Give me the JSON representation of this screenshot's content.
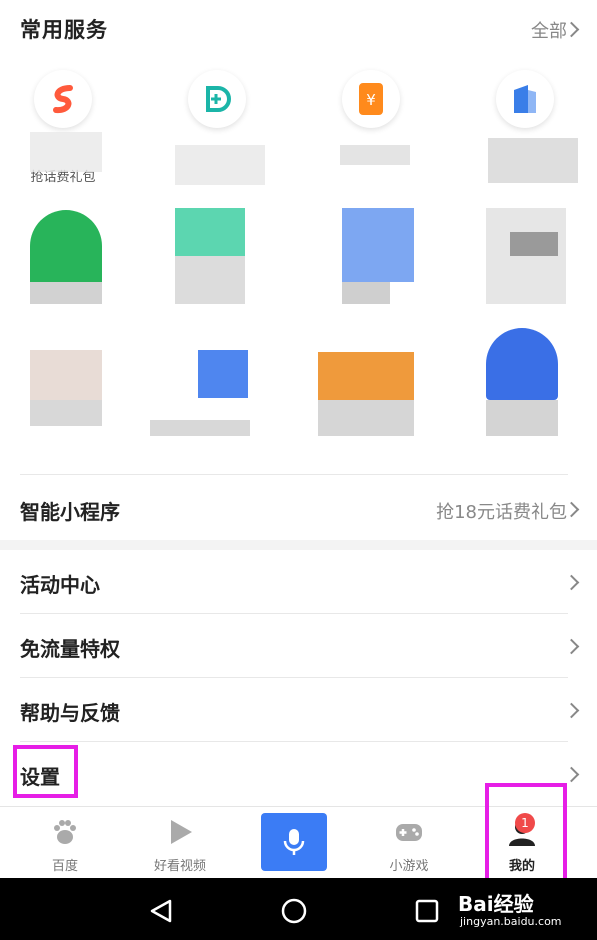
{
  "header": {
    "title": "常用服务",
    "all_label": "全部"
  },
  "services": [
    {
      "label": "抢话费礼包",
      "icon": "s-logo-icon",
      "color": "#ff5a3c"
    },
    {
      "label": "",
      "icon": "d-logo-icon",
      "color": "#1bb5a8"
    },
    {
      "label": "",
      "icon": "yuan-phone-icon",
      "color": "#ff8a1c"
    },
    {
      "label": "",
      "icon": "building-icon",
      "color": "#3a7ee8"
    }
  ],
  "mini_program": {
    "title": "智能小程序",
    "promo": "抢18元话费礼包"
  },
  "list": [
    {
      "label": "活动中心"
    },
    {
      "label": "免流量特权"
    },
    {
      "label": "帮助与反馈"
    },
    {
      "label": "设置"
    }
  ],
  "tabs": [
    {
      "label": "百度",
      "icon": "paw-icon"
    },
    {
      "label": "好看视频",
      "icon": "play-icon"
    },
    {
      "label": "",
      "icon": "microphone-icon"
    },
    {
      "label": "小游戏",
      "icon": "gamepad-icon"
    },
    {
      "label": "我的",
      "icon": "user-icon",
      "badge": "1"
    }
  ],
  "watermark": {
    "brand": "Bai经验",
    "url": "jingyan.baidu.com"
  },
  "colors": {
    "highlight": "#e61ee6",
    "accent": "#3b7cf5",
    "badge": "#f04a4a"
  }
}
